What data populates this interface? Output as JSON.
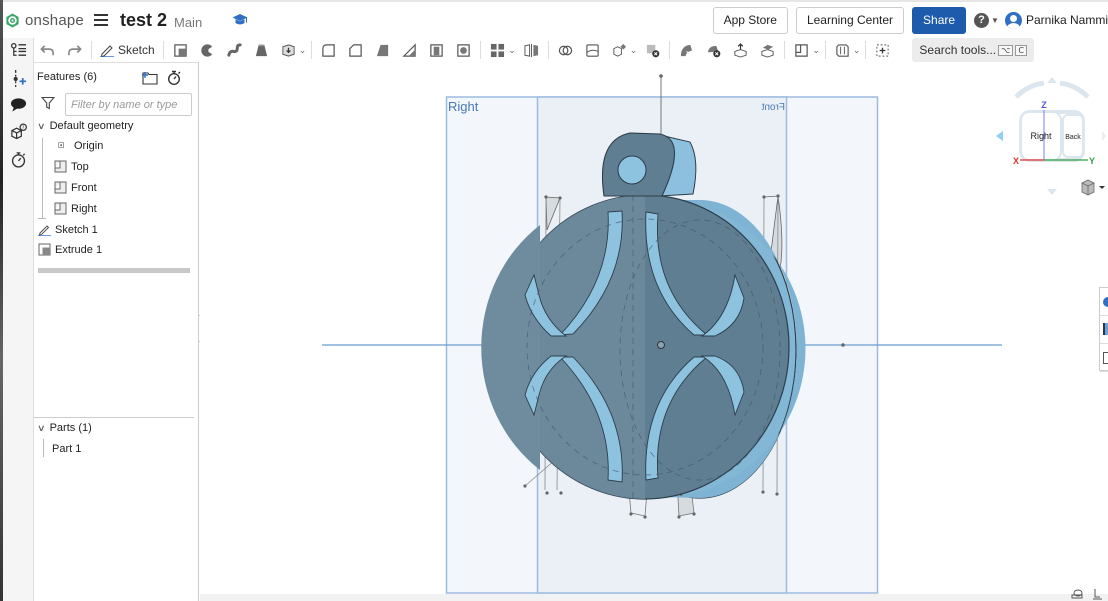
{
  "topbar": {
    "brand": "onshape",
    "doc_title": "test 2",
    "branch": "Main",
    "app_store": "App Store",
    "learning_center": "Learning Center",
    "share": "Share",
    "help": "?",
    "user_name": "Parnika Nammi"
  },
  "toolbar": {
    "sketch_label": "Sketch",
    "search_label": "Search tools...",
    "search_shortcut_1": "⌥",
    "search_shortcut_2": "C",
    "icons": [
      "undo-icon",
      "redo-icon",
      "extrude-icon",
      "revolve-icon",
      "sweep-icon",
      "loft-icon",
      "thicken-icon",
      "fillet-icon",
      "chamfer-icon",
      "draft-icon",
      "rib-icon",
      "shell-icon",
      "hole-icon",
      "pattern-icon",
      "mirror-icon",
      "boolean-icon",
      "split-icon",
      "transform-icon",
      "delete-part-icon",
      "modify-fillet-icon",
      "delete-face-icon",
      "move-face-icon",
      "replace-face-icon",
      "plane-icon",
      "mate-connector-icon",
      "section-view-icon"
    ]
  },
  "features": {
    "header": "Features (6)",
    "filter_placeholder": "Filter by name or type",
    "default_geometry": "Default geometry",
    "items": [
      {
        "label": "Origin",
        "icon": "origin-icon"
      },
      {
        "label": "Top",
        "icon": "plane-icon"
      },
      {
        "label": "Front",
        "icon": "plane-icon"
      },
      {
        "label": "Right",
        "icon": "plane-icon"
      }
    ],
    "sketch": "Sketch 1",
    "extrude": "Extrude 1"
  },
  "parts": {
    "header": "Parts (1)",
    "items": [
      "Part 1"
    ]
  },
  "viewport": {
    "plane_right_label": "Right",
    "plane_front_label": "Front",
    "viewcube": {
      "face_front": "Right",
      "face_side": "Back",
      "axis_z": "Z",
      "axis_x": "X",
      "axis_y": "Y"
    }
  },
  "colors": {
    "accent": "#1e5bad",
    "brand_green": "#3aa667",
    "part_dark": "#5f7e92",
    "part_light": "#8ec3e0",
    "plane_border": "#9dbbe0",
    "axis_x": "#e03030",
    "axis_y": "#30a040",
    "axis_z": "#5050e0"
  }
}
